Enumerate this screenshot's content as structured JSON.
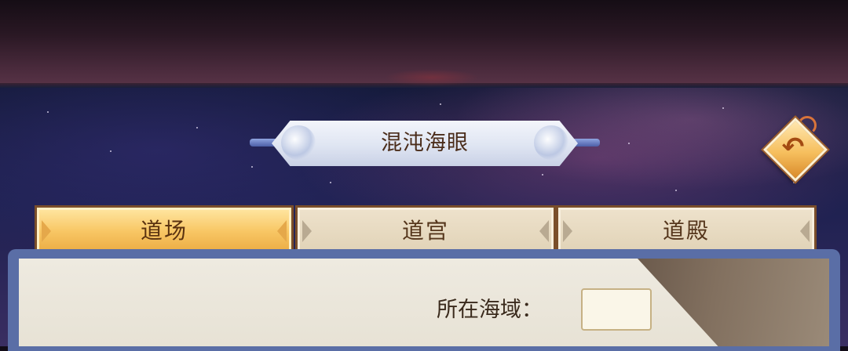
{
  "title": "混沌海眼",
  "tabs": [
    {
      "label": "道场",
      "active": true
    },
    {
      "label": "道宫",
      "active": false
    },
    {
      "label": "道殿",
      "active": false
    }
  ],
  "back_button": {
    "icon": "return-arrow-icon",
    "glyph": "↶"
  },
  "field": {
    "label": "所在海域：",
    "value": ""
  },
  "colors": {
    "active_tab": "#f8c765",
    "inactive_tab": "#e6d9c2",
    "text_brown": "#4a2c1a",
    "sky": "#1e2150",
    "panel": "#eeeae0"
  }
}
